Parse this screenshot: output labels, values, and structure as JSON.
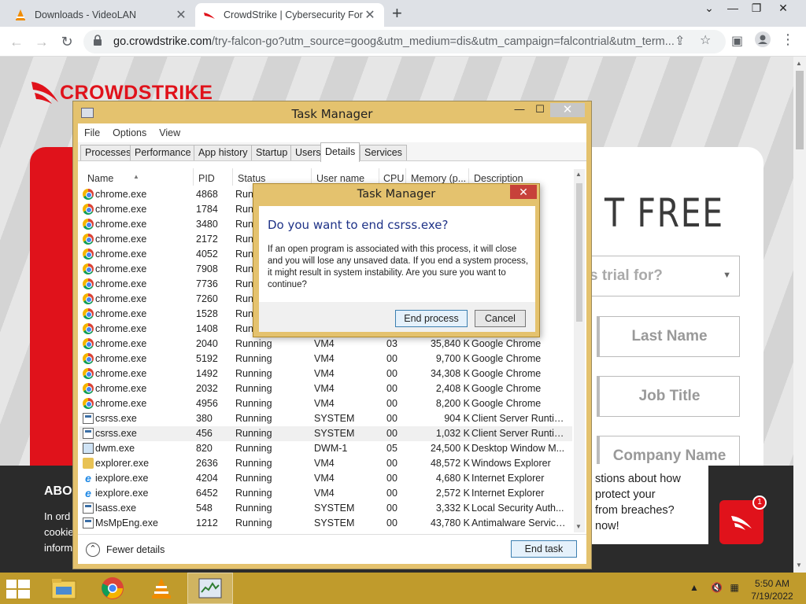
{
  "browser": {
    "tabs": [
      {
        "title": "Downloads - VideoLAN",
        "active": false
      },
      {
        "title": "CrowdStrike | Cybersecurity For Y",
        "active": true
      }
    ],
    "url_host": "go.crowdstrike.com",
    "url_path": "/try-falcon-go?utm_source=goog&utm_medium=dis&utm_campaign=falcontrial&utm_term..."
  },
  "page": {
    "brand": "CROWDSTRIKE",
    "headline_fragment": "T FREE",
    "select_fragment": "s trial for?",
    "fields": [
      "Last Name",
      "Job Title",
      "Company Name"
    ],
    "about_title": "ABO",
    "about_lines": [
      "In ord",
      "cookie",
      "inform"
    ],
    "chat_lines": [
      "stions about how",
      "protect your",
      "from breaches?",
      "now!"
    ],
    "chat_badge": "1",
    "accent_color": "#e0121b"
  },
  "task_manager": {
    "title": "Task Manager",
    "menu": [
      "File",
      "Options",
      "View"
    ],
    "tabs": [
      "Processes",
      "Performance",
      "App history",
      "Startup",
      "Users",
      "Details",
      "Services"
    ],
    "active_tab": "Details",
    "columns": [
      "Name",
      "PID",
      "Status",
      "User name",
      "CPU",
      "Memory (p...",
      "Description"
    ],
    "rows": [
      {
        "icon": "chrome",
        "name": "chrome.exe",
        "pid": "4868",
        "status": "Run",
        "user": "",
        "cpu": "",
        "mem": "",
        "desc": ""
      },
      {
        "icon": "chrome",
        "name": "chrome.exe",
        "pid": "1784",
        "status": "Run",
        "user": "",
        "cpu": "",
        "mem": "",
        "desc": ""
      },
      {
        "icon": "chrome",
        "name": "chrome.exe",
        "pid": "3480",
        "status": "Run",
        "user": "",
        "cpu": "",
        "mem": "",
        "desc": ""
      },
      {
        "icon": "chrome",
        "name": "chrome.exe",
        "pid": "2172",
        "status": "Run",
        "user": "",
        "cpu": "",
        "mem": "",
        "desc": ""
      },
      {
        "icon": "chrome",
        "name": "chrome.exe",
        "pid": "4052",
        "status": "Run",
        "user": "",
        "cpu": "",
        "mem": "",
        "desc": ""
      },
      {
        "icon": "chrome",
        "name": "chrome.exe",
        "pid": "7908",
        "status": "Run",
        "user": "",
        "cpu": "",
        "mem": "",
        "desc": ""
      },
      {
        "icon": "chrome",
        "name": "chrome.exe",
        "pid": "7736",
        "status": "Run",
        "user": "",
        "cpu": "",
        "mem": "",
        "desc": ""
      },
      {
        "icon": "chrome",
        "name": "chrome.exe",
        "pid": "7260",
        "status": "Run",
        "user": "",
        "cpu": "",
        "mem": "",
        "desc": ""
      },
      {
        "icon": "chrome",
        "name": "chrome.exe",
        "pid": "1528",
        "status": "Run",
        "user": "",
        "cpu": "",
        "mem": "",
        "desc": ""
      },
      {
        "icon": "chrome",
        "name": "chrome.exe",
        "pid": "1408",
        "status": "Run",
        "user": "",
        "cpu": "",
        "mem": "",
        "desc": ""
      },
      {
        "icon": "chrome",
        "name": "chrome.exe",
        "pid": "2040",
        "status": "Running",
        "user": "VM4",
        "cpu": "03",
        "mem": "35,840 K",
        "desc": "Google Chrome"
      },
      {
        "icon": "chrome",
        "name": "chrome.exe",
        "pid": "5192",
        "status": "Running",
        "user": "VM4",
        "cpu": "00",
        "mem": "9,700 K",
        "desc": "Google Chrome"
      },
      {
        "icon": "chrome",
        "name": "chrome.exe",
        "pid": "1492",
        "status": "Running",
        "user": "VM4",
        "cpu": "00",
        "mem": "34,308 K",
        "desc": "Google Chrome"
      },
      {
        "icon": "chrome",
        "name": "chrome.exe",
        "pid": "2032",
        "status": "Running",
        "user": "VM4",
        "cpu": "00",
        "mem": "2,408 K",
        "desc": "Google Chrome"
      },
      {
        "icon": "chrome",
        "name": "chrome.exe",
        "pid": "4956",
        "status": "Running",
        "user": "VM4",
        "cpu": "00",
        "mem": "8,200 K",
        "desc": "Google Chrome"
      },
      {
        "icon": "exe",
        "name": "csrss.exe",
        "pid": "380",
        "status": "Running",
        "user": "SYSTEM",
        "cpu": "00",
        "mem": "904 K",
        "desc": "Client Server Runtim..."
      },
      {
        "icon": "exe",
        "name": "csrss.exe",
        "pid": "456",
        "status": "Running",
        "user": "SYSTEM",
        "cpu": "00",
        "mem": "1,032 K",
        "desc": "Client Server Runtim...",
        "selected": true
      },
      {
        "icon": "dwm",
        "name": "dwm.exe",
        "pid": "820",
        "status": "Running",
        "user": "DWM-1",
        "cpu": "05",
        "mem": "24,500 K",
        "desc": "Desktop Window M..."
      },
      {
        "icon": "folder",
        "name": "explorer.exe",
        "pid": "2636",
        "status": "Running",
        "user": "VM4",
        "cpu": "00",
        "mem": "48,572 K",
        "desc": "Windows Explorer"
      },
      {
        "icon": "ie",
        "name": "iexplore.exe",
        "pid": "4204",
        "status": "Running",
        "user": "VM4",
        "cpu": "00",
        "mem": "4,680 K",
        "desc": "Internet Explorer"
      },
      {
        "icon": "ie",
        "name": "iexplore.exe",
        "pid": "6452",
        "status": "Running",
        "user": "VM4",
        "cpu": "00",
        "mem": "2,572 K",
        "desc": "Internet Explorer"
      },
      {
        "icon": "exe",
        "name": "lsass.exe",
        "pid": "548",
        "status": "Running",
        "user": "SYSTEM",
        "cpu": "00",
        "mem": "3,332 K",
        "desc": "Local Security Auth..."
      },
      {
        "icon": "exe",
        "name": "MsMpEng.exe",
        "pid": "1212",
        "status": "Running",
        "user": "SYSTEM",
        "cpu": "00",
        "mem": "43,780 K",
        "desc": "Antimalware Service..."
      }
    ],
    "fewer_details": "Fewer details",
    "end_task": "End task"
  },
  "dialog": {
    "title": "Task Manager",
    "question": "Do you want to end csrss.exe?",
    "message": "If an open program is associated with this process, it will close and you will lose any unsaved data. If you end a system process, it might result in system instability. Are you sure you want to continue?",
    "primary": "End process",
    "cancel": "Cancel"
  },
  "taskbar": {
    "apps": [
      "file-explorer",
      "chrome",
      "vlc",
      "task-manager"
    ],
    "active_app": "task-manager",
    "time": "5:50 AM",
    "date": "7/19/2022"
  }
}
